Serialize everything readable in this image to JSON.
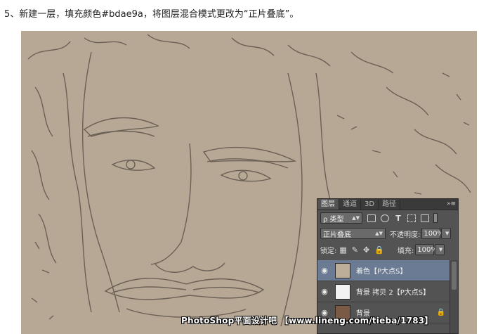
{
  "instruction": "5、新建一层，填充颜色#bdae9a，将图层混合模式更改为“正片叠底”。",
  "colors": {
    "canvas_bg": "#b7a896",
    "line_art": "#5e544a",
    "fill_layer": "#bdae9a",
    "panel_bg": "#535353",
    "selected_row": "#6a7b93"
  },
  "layers_panel": {
    "tabs": [
      "图层",
      "通道",
      "3D",
      "路径"
    ],
    "menu_icon": "»≡",
    "filter": {
      "label": "ρ 类型"
    },
    "blend_mode": "正片叠底",
    "opacity_label": "不透明度:",
    "opacity_value": "100%",
    "lock_label": "锁定:",
    "fill_label": "填充:",
    "fill_value": "100%",
    "layers": [
      {
        "name": "着色【P大点S】",
        "visible": true,
        "selected": true
      },
      {
        "name": "背景 拷贝 2【P大点S】",
        "visible": true,
        "selected": false
      },
      {
        "name": "背景",
        "visible": true,
        "selected": false
      }
    ]
  },
  "watermark": "PhotoShop平面设计吧 【www.lineng.com/tieba/1783】"
}
